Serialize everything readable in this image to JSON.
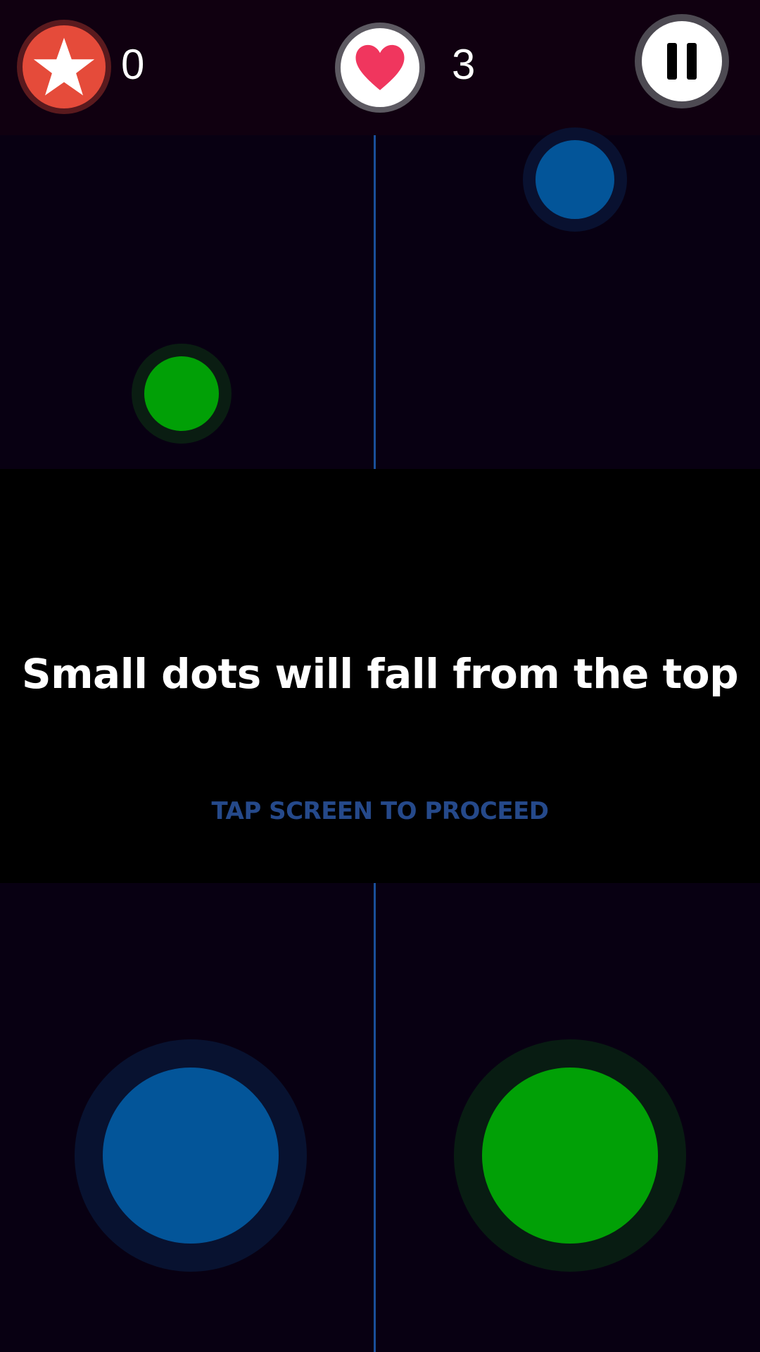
{
  "hud": {
    "score": "0",
    "lives": "3",
    "score_icon": "star-icon",
    "lives_icon": "heart-icon",
    "pause_icon": "pause-icon"
  },
  "tutorial": {
    "message": "Small dots will fall from the top",
    "prompt": "TAP SCREEN TO PROCEED"
  },
  "lanes": {
    "left_target_color": "blue",
    "right_target_color": "green"
  },
  "colors": {
    "blue_dot": "#035599",
    "green_dot": "#01a006",
    "star_badge": "#e54b3a",
    "heart": "#f0365e",
    "divider": "#1a4f9a",
    "prompt_text": "#25498a"
  }
}
